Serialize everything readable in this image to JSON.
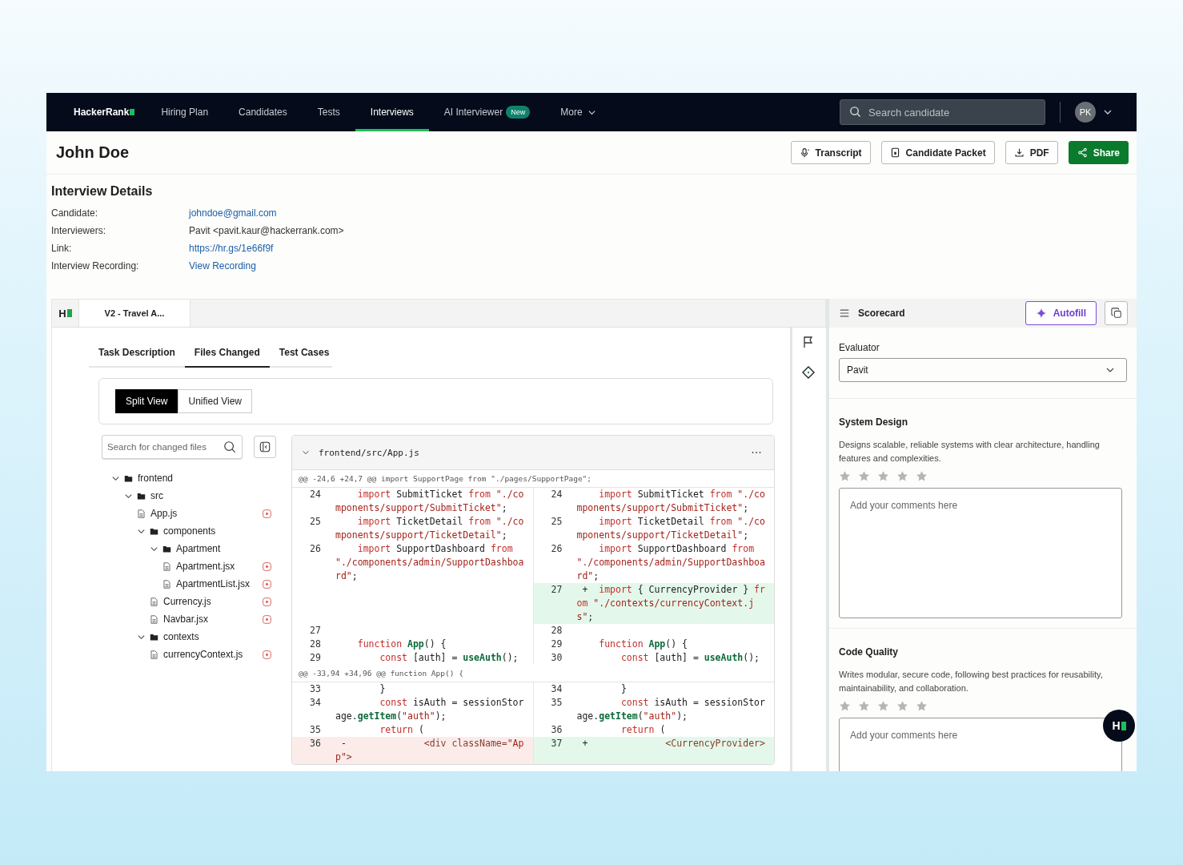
{
  "nav": {
    "logo": "HackerRank",
    "items": [
      {
        "label": "Hiring Plan",
        "selected": false,
        "dropdown": false
      },
      {
        "label": "Candidates",
        "selected": false,
        "dropdown": false
      },
      {
        "label": "Tests",
        "selected": false,
        "dropdown": false
      },
      {
        "label": "Interviews",
        "selected": true,
        "dropdown": false
      },
      {
        "label": "AI Interviewer",
        "selected": false,
        "dropdown": false,
        "badge": "New"
      },
      {
        "label": "More",
        "selected": false,
        "dropdown": true
      }
    ],
    "search": {
      "placeholder": "Search candidate"
    },
    "avatar": "PK"
  },
  "header": {
    "name": "John Doe",
    "buttons": [
      {
        "label": "Transcript",
        "kind": "transcript",
        "primary": false
      },
      {
        "label": "Candidate Packet",
        "kind": "packet",
        "primary": false
      },
      {
        "label": "PDF",
        "kind": "download",
        "primary": false
      },
      {
        "label": "Share",
        "kind": "share",
        "primary": true
      }
    ]
  },
  "details": {
    "title": "Interview Details",
    "rows": [
      {
        "label": "Candidate:",
        "value": "johndoe@gmail.com",
        "link": true
      },
      {
        "label": "Interviewers:",
        "value": "Pavit <pavit.kaur@hackerrank.com>",
        "link": false
      },
      {
        "label": "Link:",
        "value": "https://hr.gs/1e66f9f",
        "link": true
      },
      {
        "label": "Interview Recording:",
        "value": "View Recording",
        "link": true
      }
    ]
  },
  "workspace": {
    "logo": "H",
    "tab": "V2 - Travel A...",
    "subtabs": [
      {
        "label": "Task Description",
        "selected": false
      },
      {
        "label": "Files Changed",
        "selected": true
      },
      {
        "label": "Test Cases",
        "selected": false
      }
    ],
    "views": [
      {
        "label": "Split View",
        "selected": true
      },
      {
        "label": "Unified View",
        "selected": false
      }
    ],
    "file_search": {
      "placeholder": "Search for changed files"
    },
    "tree": [
      {
        "name": "frontend",
        "kind": "folder",
        "expanded": true,
        "children": [
          {
            "name": "src",
            "kind": "folder",
            "expanded": true,
            "children": [
              {
                "name": "App.js",
                "kind": "file"
              },
              {
                "name": "components",
                "kind": "folder",
                "expanded": true,
                "children": [
                  {
                    "name": "Apartment",
                    "kind": "folder",
                    "expanded": true,
                    "children": [
                      {
                        "name": "Apartment.jsx",
                        "kind": "file"
                      },
                      {
                        "name": "ApartmentList.jsx",
                        "kind": "file"
                      }
                    ]
                  },
                  {
                    "name": "Currency.js",
                    "kind": "file"
                  },
                  {
                    "name": "Navbar.jsx",
                    "kind": "file"
                  }
                ]
              },
              {
                "name": "contexts",
                "kind": "folder",
                "expanded": true,
                "children": [
                  {
                    "name": "currencyContext.js",
                    "kind": "file"
                  }
                ]
              }
            ]
          }
        ]
      }
    ],
    "diff": {
      "file": "frontend/src/App.js",
      "hunks": [
        {
          "header": "@@ -24,6 +24,7 @@ import SupportPage from \"./pages/SupportPage\";",
          "rows": [
            {
              "left": {
                "num": "24",
                "kind": "context",
                "segs": [
                  {
                    "kind": "kw",
                    "text": "import"
                  },
                  {
                    "kind": "plain",
                    "text": " SubmitTicket "
                  },
                  {
                    "kind": "kw",
                    "text": "from"
                  },
                  {
                    "kind": "str",
                    "text": " \"./components/support/SubmitTicket\""
                  },
                  {
                    "kind": "plain",
                    "text": ";"
                  }
                ]
              },
              "right": {
                "num": "24",
                "kind": "context",
                "segs": [
                  {
                    "kind": "kw",
                    "text": "import"
                  },
                  {
                    "kind": "plain",
                    "text": " SubmitTicket "
                  },
                  {
                    "kind": "kw",
                    "text": "from"
                  },
                  {
                    "kind": "str",
                    "text": " \"./components/support/SubmitTicket\""
                  },
                  {
                    "kind": "plain",
                    "text": ";"
                  }
                ]
              }
            },
            {
              "left": {
                "num": "25",
                "kind": "context",
                "segs": [
                  {
                    "kind": "kw",
                    "text": "import"
                  },
                  {
                    "kind": "plain",
                    "text": " TicketDetail "
                  },
                  {
                    "kind": "kw",
                    "text": "from"
                  },
                  {
                    "kind": "str",
                    "text": " \"./components/support/TicketDetail\""
                  },
                  {
                    "kind": "plain",
                    "text": ";"
                  }
                ]
              },
              "right": {
                "num": "25",
                "kind": "context",
                "segs": [
                  {
                    "kind": "kw",
                    "text": "import"
                  },
                  {
                    "kind": "plain",
                    "text": " TicketDetail "
                  },
                  {
                    "kind": "kw",
                    "text": "from"
                  },
                  {
                    "kind": "str",
                    "text": " \"./components/support/TicketDetail\""
                  },
                  {
                    "kind": "plain",
                    "text": ";"
                  }
                ]
              }
            },
            {
              "left": {
                "num": "26",
                "kind": "context",
                "segs": [
                  {
                    "kind": "kw",
                    "text": "import"
                  },
                  {
                    "kind": "plain",
                    "text": " SupportDashboard "
                  },
                  {
                    "kind": "kw",
                    "text": "from"
                  },
                  {
                    "kind": "str",
                    "text": " \"./components/admin/SupportDashboard\""
                  },
                  {
                    "kind": "plain",
                    "text": ";"
                  }
                ]
              },
              "right": {
                "num": "26",
                "kind": "context",
                "segs": [
                  {
                    "kind": "kw",
                    "text": "import"
                  },
                  {
                    "kind": "plain",
                    "text": " SupportDashboard "
                  },
                  {
                    "kind": "kw",
                    "text": "from"
                  },
                  {
                    "kind": "str",
                    "text": " \"./components/admin/SupportDashboard\""
                  },
                  {
                    "kind": "plain",
                    "text": ";"
                  }
                ]
              }
            },
            {
              "right": {
                "num": "27",
                "kind": "added",
                "sign": "+",
                "segs": [
                  {
                    "kind": "kw",
                    "text": "import"
                  },
                  {
                    "kind": "plain",
                    "text": " { CurrencyProvider } "
                  },
                  {
                    "kind": "kw",
                    "text": "from"
                  },
                  {
                    "kind": "str",
                    "text": " \"./contexts/currencyContext.js\""
                  },
                  {
                    "kind": "plain",
                    "text": ";"
                  }
                ]
              }
            },
            {
              "left": {
                "num": "27",
                "kind": "context"
              },
              "right": {
                "num": "28",
                "kind": "context"
              }
            },
            {
              "left": {
                "num": "28",
                "kind": "context",
                "segs": [
                  {
                    "kind": "kw",
                    "text": "function"
                  },
                  {
                    "kind": "fn",
                    "text": " App"
                  },
                  {
                    "kind": "plain",
                    "text": "() {"
                  }
                ]
              },
              "right": {
                "num": "29",
                "kind": "context",
                "segs": [
                  {
                    "kind": "kw",
                    "text": "function"
                  },
                  {
                    "kind": "fn",
                    "text": " App"
                  },
                  {
                    "kind": "plain",
                    "text": "() {"
                  }
                ]
              }
            },
            {
              "left": {
                "num": "29",
                "kind": "context",
                "segs": [
                  {
                    "kind": "kw",
                    "text": "    const"
                  },
                  {
                    "kind": "plain",
                    "text": " [auth] = "
                  },
                  {
                    "kind": "fn",
                    "text": "useAuth"
                  },
                  {
                    "kind": "plain",
                    "text": "();"
                  }
                ]
              },
              "right": {
                "num": "30",
                "kind": "context",
                "segs": [
                  {
                    "kind": "kw",
                    "text": "    const"
                  },
                  {
                    "kind": "plain",
                    "text": " [auth] = "
                  },
                  {
                    "kind": "fn",
                    "text": "useAuth"
                  },
                  {
                    "kind": "plain",
                    "text": "();"
                  }
                ]
              }
            }
          ]
        },
        {
          "header": "@@ -33,94 +34,96 @@ function App() {",
          "rows": [
            {
              "left": {
                "num": "33",
                "kind": "context",
                "segs": [
                  {
                    "kind": "plain",
                    "text": "    }"
                  }
                ]
              },
              "right": {
                "num": "34",
                "kind": "context",
                "segs": [
                  {
                    "kind": "plain",
                    "text": "    }"
                  }
                ]
              }
            },
            {
              "left": {
                "num": "34",
                "kind": "context",
                "segs": [
                  {
                    "kind": "kw",
                    "text": "    const"
                  },
                  {
                    "kind": "plain",
                    "text": " isAuth = sessionStorage."
                  },
                  {
                    "kind": "fn",
                    "text": "getItem"
                  },
                  {
                    "kind": "plain",
                    "text": "("
                  },
                  {
                    "kind": "str",
                    "text": "\"auth\""
                  },
                  {
                    "kind": "plain",
                    "text": ");"
                  }
                ]
              },
              "right": {
                "num": "35",
                "kind": "context",
                "segs": [
                  {
                    "kind": "kw",
                    "text": "    const"
                  },
                  {
                    "kind": "plain",
                    "text": " isAuth = sessionStorage."
                  },
                  {
                    "kind": "fn",
                    "text": "getItem"
                  },
                  {
                    "kind": "plain",
                    "text": "("
                  },
                  {
                    "kind": "str",
                    "text": "\"auth\""
                  },
                  {
                    "kind": "plain",
                    "text": ");"
                  }
                ]
              }
            },
            {
              "left": {
                "num": "35",
                "kind": "context",
                "segs": [
                  {
                    "kind": "kw",
                    "text": "    return"
                  },
                  {
                    "kind": "plain",
                    "text": " ("
                  }
                ]
              },
              "right": {
                "num": "36",
                "kind": "context",
                "segs": [
                  {
                    "kind": "kw",
                    "text": "    return"
                  },
                  {
                    "kind": "plain",
                    "text": " ("
                  }
                ]
              }
            },
            {
              "left": {
                "num": "36",
                "kind": "removed",
                "sign": "-",
                "segs": [
                  {
                    "kind": "tag",
                    "text": "            <div className="
                  },
                  {
                    "kind": "str",
                    "text": "\"App\""
                  },
                  {
                    "kind": "tag",
                    "text": ">"
                  }
                ]
              },
              "right": {
                "num": "37",
                "kind": "added",
                "sign": "+",
                "segs": [
                  {
                    "kind": "tag",
                    "text": "            <CurrencyProvider>"
                  }
                ]
              }
            }
          ]
        }
      ]
    }
  },
  "scorecard": {
    "title": "Scorecard",
    "autofill": "Autofill",
    "evaluator_label": "Evaluator",
    "evaluator": "Pavit",
    "criteria": [
      {
        "title": "System Design",
        "description": "Designs scalable, reliable systems with clear architecture, handling features and complexities.",
        "stars": 0,
        "placeholder": "Add your comments here"
      },
      {
        "title": "Code Quality",
        "description": "Writes modular, secure code, following best practices for reusability, maintainability, and collaboration.",
        "stars": 0,
        "placeholder": "Add your comments here"
      }
    ]
  },
  "chat_button": {
    "logo": "H"
  }
}
